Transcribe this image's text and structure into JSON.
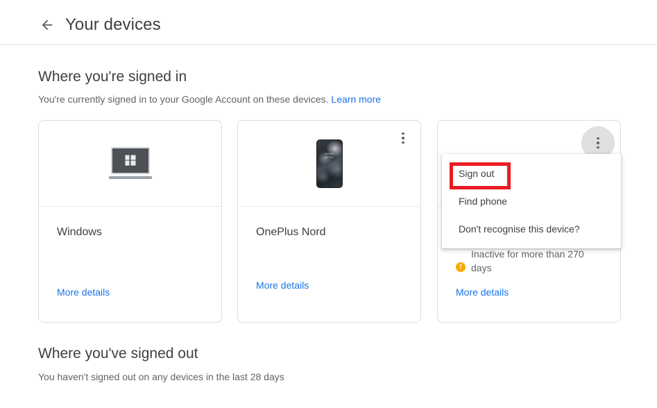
{
  "header": {
    "back_icon": "arrow-left-icon",
    "title": "Your devices"
  },
  "signed_in_section": {
    "title": "Where you're signed in",
    "description": "You're currently signed in to your Google Account on these devices.",
    "learn_more": "Learn more"
  },
  "signed_out_section": {
    "title": "Where you've signed out",
    "description": "You haven't signed out on any devices in the last 28 days"
  },
  "cards": [
    {
      "name": "Windows",
      "icon": "windows-desktop-icon",
      "status": "",
      "more_details": "More details",
      "menu_icon": "more-vert-icon",
      "menu_open": false
    },
    {
      "name": "OnePlus Nord",
      "icon": "phone-oneplus-icon",
      "status": "",
      "more_details": "More details",
      "menu_icon": "more-vert-icon",
      "menu_open": false
    },
    {
      "name": "",
      "icon": "phone-generic-icon",
      "status": "Inactive for more than 270 days",
      "warning_glyph": "!",
      "more_details": "More details",
      "menu_icon": "more-vert-icon",
      "menu_open": true
    }
  ],
  "dropdown_menu": {
    "items": [
      {
        "label": "Sign out",
        "highlighted": true
      },
      {
        "label": "Find phone",
        "highlighted": false
      },
      {
        "label": "Don't recognise this device?",
        "highlighted": false
      }
    ]
  },
  "colors": {
    "link": "#1a73e8",
    "annotation": "#ec1c24",
    "warning": "#f9ab00",
    "text_primary": "#3c4043",
    "text_secondary": "#5f6368",
    "card_border": "#dadce0"
  }
}
